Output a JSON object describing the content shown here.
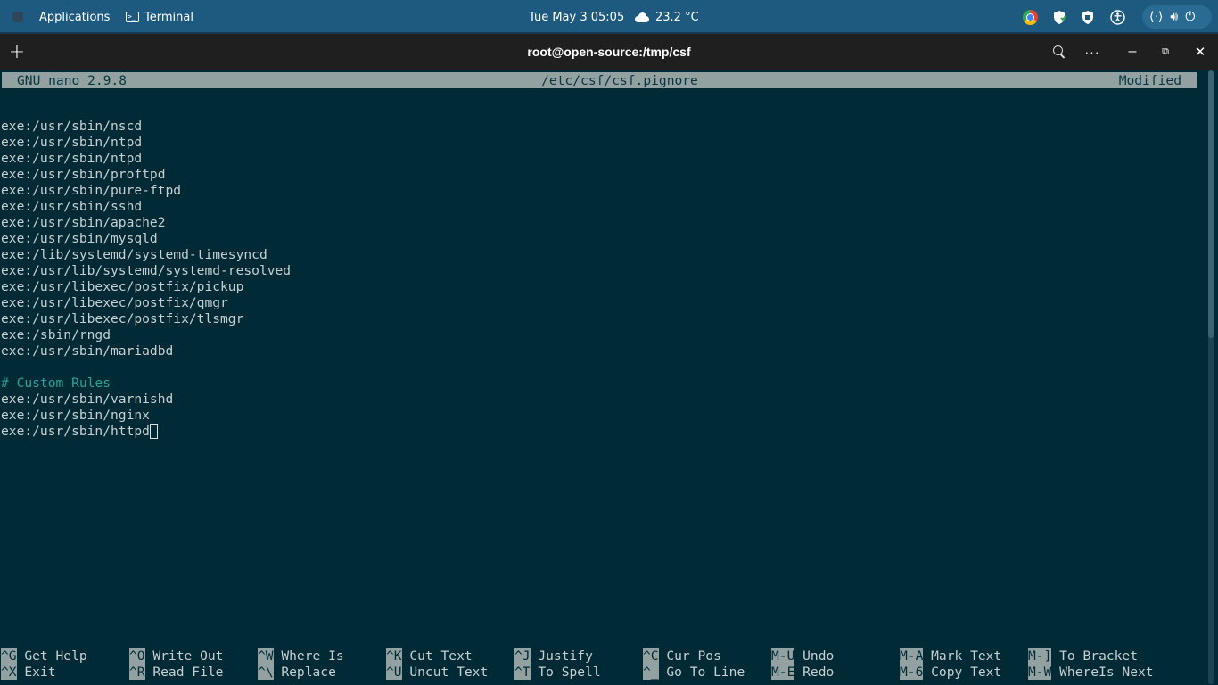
{
  "topbar": {
    "applications": "Applications",
    "terminal_app": "Terminal",
    "clock": "Tue May 3  05:05",
    "weather": "23.2 °C"
  },
  "window": {
    "title": "root@open-source:/tmp/csf"
  },
  "nano": {
    "version": "GNU nano 2.9.8",
    "filename": "/etc/csf/csf.pignore",
    "status": "Modified",
    "lines": [
      {
        "text": ""
      },
      {
        "text": "exe:/usr/sbin/nscd"
      },
      {
        "text": "exe:/usr/sbin/ntpd"
      },
      {
        "text": "exe:/usr/sbin/ntpd"
      },
      {
        "text": "exe:/usr/sbin/proftpd"
      },
      {
        "text": "exe:/usr/sbin/pure-ftpd"
      },
      {
        "text": "exe:/usr/sbin/sshd"
      },
      {
        "text": "exe:/usr/sbin/apache2"
      },
      {
        "text": "exe:/usr/sbin/mysqld"
      },
      {
        "text": "exe:/lib/systemd/systemd-timesyncd"
      },
      {
        "text": "exe:/usr/lib/systemd/systemd-resolved"
      },
      {
        "text": "exe:/usr/libexec/postfix/pickup"
      },
      {
        "text": "exe:/usr/libexec/postfix/qmgr"
      },
      {
        "text": "exe:/usr/libexec/postfix/tlsmgr"
      },
      {
        "text": "exe:/sbin/rngd"
      },
      {
        "text": "exe:/usr/sbin/mariadbd"
      },
      {
        "text": ""
      },
      {
        "text": "# Custom Rules",
        "comment": true
      },
      {
        "text": "exe:/usr/sbin/varnishd"
      },
      {
        "text": "exe:/usr/sbin/nginx"
      },
      {
        "text": "exe:/usr/sbin/httpd",
        "cursor": true
      }
    ],
    "shortcuts": [
      [
        {
          "key": "^G",
          "label": "Get Help"
        },
        {
          "key": "^X",
          "label": "Exit"
        }
      ],
      [
        {
          "key": "^O",
          "label": "Write Out"
        },
        {
          "key": "^R",
          "label": "Read File"
        }
      ],
      [
        {
          "key": "^W",
          "label": "Where Is"
        },
        {
          "key": "^\\",
          "label": "Replace"
        }
      ],
      [
        {
          "key": "^K",
          "label": "Cut Text"
        },
        {
          "key": "^U",
          "label": "Uncut Text"
        }
      ],
      [
        {
          "key": "^J",
          "label": "Justify"
        },
        {
          "key": "^T",
          "label": "To Spell"
        }
      ],
      [
        {
          "key": "^C",
          "label": "Cur Pos"
        },
        {
          "key": "^_",
          "label": "Go To Line"
        }
      ],
      [
        {
          "key": "M-U",
          "label": "Undo"
        },
        {
          "key": "M-E",
          "label": "Redo"
        }
      ],
      [
        {
          "key": "M-A",
          "label": "Mark Text"
        },
        {
          "key": "M-6",
          "label": "Copy Text"
        }
      ],
      [
        {
          "key": "M-]",
          "label": "To Bracket"
        },
        {
          "key": "M-W",
          "label": "WhereIs Next"
        }
      ]
    ]
  }
}
